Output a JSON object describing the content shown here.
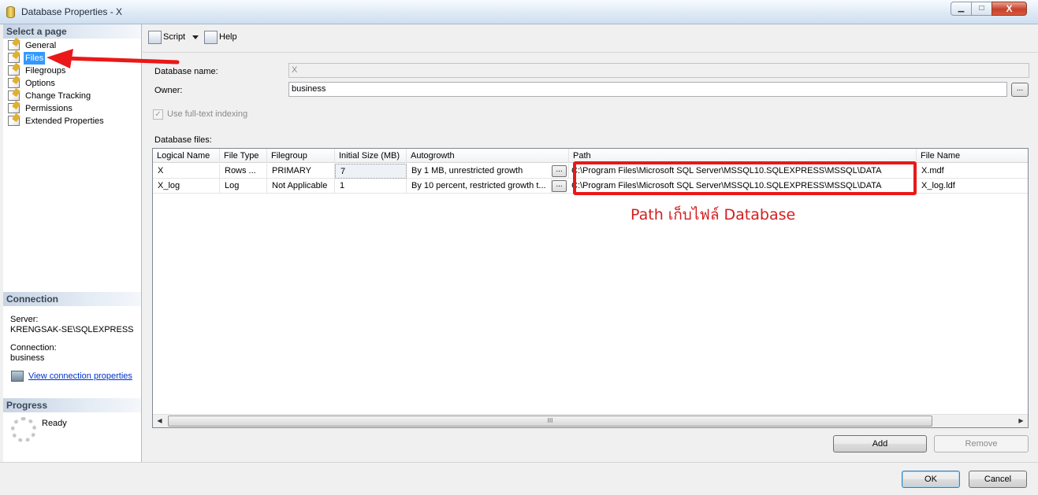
{
  "window": {
    "title": "Database Properties - X",
    "min": "▁",
    "max": "□",
    "close": "X"
  },
  "left": {
    "select_header": "Select a page",
    "pages": [
      {
        "label": "General"
      },
      {
        "label": "Files"
      },
      {
        "label": "Filegroups"
      },
      {
        "label": "Options"
      },
      {
        "label": "Change Tracking"
      },
      {
        "label": "Permissions"
      },
      {
        "label": "Extended Properties"
      }
    ],
    "connection_header": "Connection",
    "server_label": "Server:",
    "server_value": "KRENGSAK-SE\\SQLEXPRESS",
    "connection_label": "Connection:",
    "connection_value": "business",
    "view_link": "View connection properties",
    "progress_header": "Progress",
    "progress_status": "Ready"
  },
  "toolbar": {
    "script": "Script",
    "help": "Help"
  },
  "form": {
    "dbname_label": "Database name:",
    "dbname_value": "X",
    "owner_label": "Owner:",
    "owner_value": "business",
    "ellipsis": "...",
    "fulltext_label": "Use full-text indexing",
    "fulltext_check": "✓",
    "files_label": "Database files:"
  },
  "grid": {
    "columns": [
      "Logical Name",
      "File Type",
      "Filegroup",
      "Initial Size (MB)",
      "Autogrowth",
      "Path",
      "File Name"
    ],
    "rows": [
      {
        "logical": "X",
        "type": "Rows ...",
        "group": "PRIMARY",
        "size": "7",
        "growth": "By 1 MB, unrestricted growth",
        "path": "C:\\Program Files\\Microsoft SQL Server\\MSSQL10.SQLEXPRESS\\MSSQL\\DATA",
        "file": "X.mdf"
      },
      {
        "logical": "X_log",
        "type": "Log",
        "group": "Not Applicable",
        "size": "1",
        "growth": "By 10 percent, restricted growth t...",
        "path": "C:\\Program Files\\Microsoft SQL Server\\MSSQL10.SQLEXPRESS\\MSSQL\\DATA",
        "file": "X_log.ldf"
      }
    ],
    "scroll_left": "◀",
    "scroll_right": "▶",
    "scroll_grip": "III"
  },
  "buttons": {
    "add": "Add",
    "remove": "Remove",
    "ok": "OK",
    "cancel": "Cancel"
  },
  "annotation": {
    "text": "Path เก็บไฟล์ Database",
    "color": "#ea1818"
  }
}
